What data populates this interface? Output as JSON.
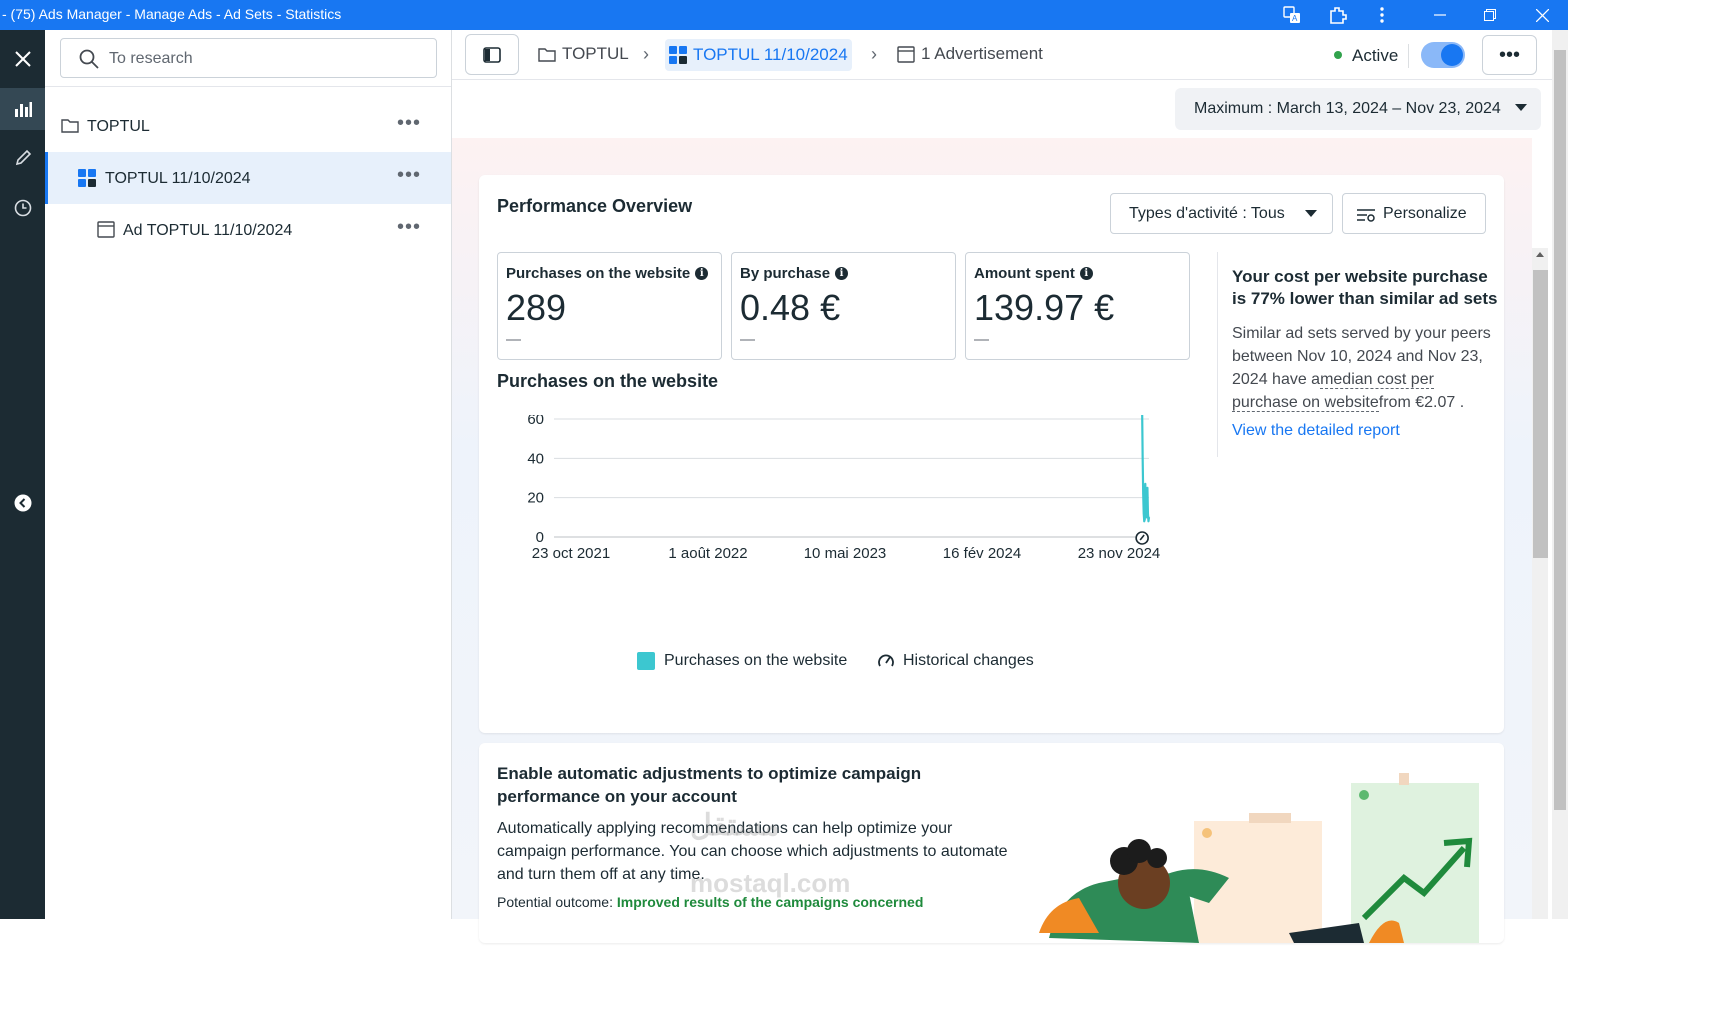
{
  "window": {
    "title": "- (75) Ads Manager - Manage Ads - Ad Sets - Statistics",
    "icons": [
      "translate-icon",
      "extension-icon",
      "kebab-menu-icon",
      "minimize-icon",
      "restore-icon",
      "close-icon"
    ]
  },
  "rail": {
    "icons": [
      "close-icon",
      "bar-chart-icon",
      "pencil-icon",
      "clock-icon",
      "collapse-arrow-icon"
    ]
  },
  "sidebar": {
    "search_placeholder": "To research",
    "items": [
      {
        "label": "TOPTUL",
        "icon": "folder-icon",
        "more": "•••"
      },
      {
        "label": "TOPTUL 11/10/2024",
        "icon": "adset-grid-icon",
        "more": "•••",
        "selected": true
      },
      {
        "label": "Ad TOPTUL 11/10/2024",
        "icon": "ad-icon",
        "more": "•••"
      }
    ]
  },
  "breadcrumb": {
    "campaign": "TOPTUL",
    "adset": "TOPTUL 11/10/2024",
    "ads": "1 Advertisement"
  },
  "status": {
    "label": "Active",
    "enabled": true,
    "more": "•••"
  },
  "date_range": {
    "label": "Maximum  : March 13, 2024 – Nov 23, 2024"
  },
  "performance": {
    "title": "Performance Overview",
    "activity_filter": "Types d'activité : Tous",
    "personalize": "Personalize",
    "metrics": [
      {
        "label": "Purchases on the website",
        "value": "289",
        "delta": "—"
      },
      {
        "label": "By purchase",
        "value": "0.48 €",
        "delta": "—"
      },
      {
        "label": "Amount spent",
        "value": "139.97 €",
        "delta": "—"
      }
    ],
    "chart_title": "Purchases on the website",
    "insight": {
      "headline": "Your cost per website purchase is 77% lower than similar ad sets",
      "body_pre": "Similar ad sets served by your peers between Nov 10, 2024 and Nov 23, 2024 have a",
      "body_term": "median cost per purchase on website",
      "body_post": "from €2.07 .",
      "link": "View the detailed report"
    },
    "legend": {
      "series": "Purchases on the website",
      "history": "Historical changes"
    }
  },
  "chart_data": {
    "type": "line",
    "title": "Purchases on the website",
    "xlabel": "",
    "ylabel": "",
    "x_ticks": [
      "23 oct 2021",
      "1 août 2022",
      "10 mai 2023",
      "16 fév 2024",
      "23 nov 2024"
    ],
    "y_ticks": [
      0,
      20,
      40,
      60
    ],
    "ylim": [
      0,
      60
    ],
    "xlim": [
      "2021-10-23",
      "2024-11-23"
    ],
    "grid": true,
    "series": [
      {
        "name": "Purchases on the website",
        "color": "#3cc7d0",
        "x": [
          "2024-11-10",
          "2024-11-11",
          "2024-11-12",
          "2024-11-13",
          "2024-11-14",
          "2024-11-15",
          "2024-11-16",
          "2024-11-17",
          "2024-11-18",
          "2024-11-19",
          "2024-11-20",
          "2024-11-21",
          "2024-11-22",
          "2024-11-23"
        ],
        "y": [
          64,
          40,
          22,
          12,
          8,
          9,
          27,
          16,
          10,
          14,
          25,
          12,
          8,
          10
        ]
      }
    ],
    "history_markers": [
      "2024-11-10"
    ]
  },
  "automation": {
    "title": "Enable automatic adjustments to optimize campaign performance on your account",
    "body": "Automatically applying recommendations can help optimize your campaign performance. You can choose which adjustments to automate and turn them off at any time.",
    "outcome_label": "Potential outcome:",
    "outcome_value": "Improved results of the campaigns concerned"
  },
  "watermark": {
    "arabic": "مستقل",
    "latin": "mostaql.com"
  }
}
